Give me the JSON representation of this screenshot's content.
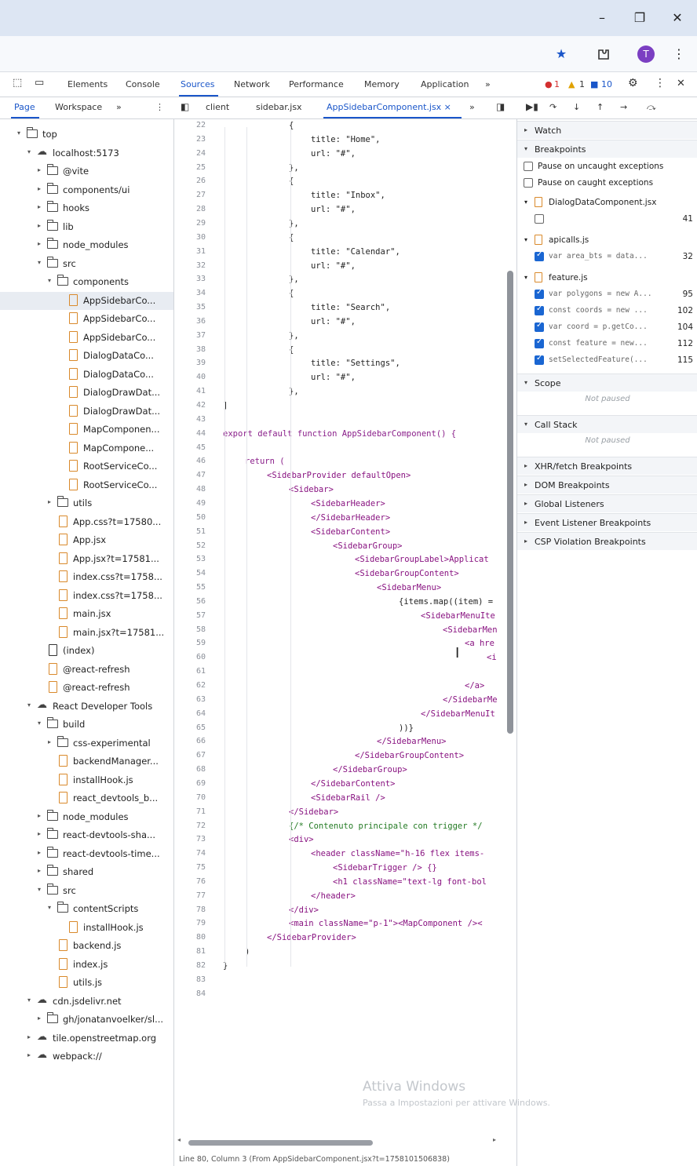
{
  "window": {
    "minimize": "–",
    "maximize": "❐",
    "close": "✕"
  },
  "browser_toolbar": {
    "icons": [
      "star-icon",
      "extension-icon",
      "profile-icon",
      "menu-icon"
    ],
    "profile_initial": "T"
  },
  "devtools_tabs": [
    "Elements",
    "Console",
    "Sources",
    "Network",
    "Performance",
    "Memory",
    "Application",
    "»"
  ],
  "devtools_active_tab": "Sources",
  "devtools_status": {
    "errors": "1",
    "warnings": "1",
    "info": "10"
  },
  "sources_subtabs": {
    "left": [
      "Page",
      "Workspace",
      "»"
    ],
    "files": [
      "client",
      "sidebar.jsx",
      "AppSidebarComponent.jsx ×"
    ],
    "more": "»"
  },
  "tree": [
    {
      "depth": 0,
      "kind": "folder",
      "twisty": "▾",
      "label": "top"
    },
    {
      "depth": 1,
      "kind": "cloud",
      "twisty": "▾",
      "label": "localhost:5173"
    },
    {
      "depth": 2,
      "kind": "folder",
      "twisty": "▸",
      "label": "@vite"
    },
    {
      "depth": 2,
      "kind": "folder",
      "twisty": "▸",
      "label": "components/ui"
    },
    {
      "depth": 2,
      "kind": "folder",
      "twisty": "▸",
      "label": "hooks"
    },
    {
      "depth": 2,
      "kind": "folder",
      "twisty": "▸",
      "label": "lib"
    },
    {
      "depth": 2,
      "kind": "folder",
      "twisty": "▸",
      "label": "node_modules"
    },
    {
      "depth": 2,
      "kind": "folder",
      "twisty": "▾",
      "label": "src"
    },
    {
      "depth": 3,
      "kind": "folder",
      "twisty": "▾",
      "label": "components"
    },
    {
      "depth": 4,
      "kind": "js",
      "twisty": "",
      "label": "AppSidebarCo...",
      "selected": true
    },
    {
      "depth": 4,
      "kind": "js",
      "twisty": "",
      "label": "AppSidebarCo..."
    },
    {
      "depth": 4,
      "kind": "js",
      "twisty": "",
      "label": "AppSidebarCo..."
    },
    {
      "depth": 4,
      "kind": "js",
      "twisty": "",
      "label": "DialogDataCo..."
    },
    {
      "depth": 4,
      "kind": "js",
      "twisty": "",
      "label": "DialogDataCo..."
    },
    {
      "depth": 4,
      "kind": "js",
      "twisty": "",
      "label": "DialogDrawDat..."
    },
    {
      "depth": 4,
      "kind": "js",
      "twisty": "",
      "label": "DialogDrawDat..."
    },
    {
      "depth": 4,
      "kind": "js",
      "twisty": "",
      "label": "MapComponen..."
    },
    {
      "depth": 4,
      "kind": "js",
      "twisty": "",
      "label": "MapCompone..."
    },
    {
      "depth": 4,
      "kind": "js",
      "twisty": "",
      "label": "RootServiceCo..."
    },
    {
      "depth": 4,
      "kind": "js",
      "twisty": "",
      "label": "RootServiceCo..."
    },
    {
      "depth": 3,
      "kind": "folder",
      "twisty": "▸",
      "label": "utils"
    },
    {
      "depth": 3,
      "kind": "js",
      "twisty": "",
      "label": "App.css?t=17580..."
    },
    {
      "depth": 3,
      "kind": "js",
      "twisty": "",
      "label": "App.jsx"
    },
    {
      "depth": 3,
      "kind": "js",
      "twisty": "",
      "label": "App.jsx?t=17581..."
    },
    {
      "depth": 3,
      "kind": "js",
      "twisty": "",
      "label": "index.css?t=1758..."
    },
    {
      "depth": 3,
      "kind": "js",
      "twisty": "",
      "label": "index.css?t=1758..."
    },
    {
      "depth": 3,
      "kind": "js",
      "twisty": "",
      "label": "main.jsx"
    },
    {
      "depth": 3,
      "kind": "js",
      "twisty": "",
      "label": "main.jsx?t=17581..."
    },
    {
      "depth": 2,
      "kind": "file",
      "twisty": "",
      "label": "(index)"
    },
    {
      "depth": 2,
      "kind": "js",
      "twisty": "",
      "label": "@react-refresh"
    },
    {
      "depth": 2,
      "kind": "js",
      "twisty": "",
      "label": "@react-refresh"
    },
    {
      "depth": 1,
      "kind": "cloud",
      "twisty": "▾",
      "label": "React Developer Tools"
    },
    {
      "depth": 2,
      "kind": "folder",
      "twisty": "▾",
      "label": "build"
    },
    {
      "depth": 3,
      "kind": "folder",
      "twisty": "▸",
      "label": "css-experimental"
    },
    {
      "depth": 3,
      "kind": "js",
      "twisty": "",
      "label": "backendManager..."
    },
    {
      "depth": 3,
      "kind": "js",
      "twisty": "",
      "label": "installHook.js"
    },
    {
      "depth": 3,
      "kind": "js",
      "twisty": "",
      "label": "react_devtools_b..."
    },
    {
      "depth": 2,
      "kind": "folder",
      "twisty": "▸",
      "label": "node_modules"
    },
    {
      "depth": 2,
      "kind": "folder",
      "twisty": "▸",
      "label": "react-devtools-sha..."
    },
    {
      "depth": 2,
      "kind": "folder",
      "twisty": "▸",
      "label": "react-devtools-time..."
    },
    {
      "depth": 2,
      "kind": "folder",
      "twisty": "▸",
      "label": "shared"
    },
    {
      "depth": 2,
      "kind": "folder",
      "twisty": "▾",
      "label": "src"
    },
    {
      "depth": 3,
      "kind": "folder",
      "twisty": "▾",
      "label": "contentScripts"
    },
    {
      "depth": 4,
      "kind": "js",
      "twisty": "",
      "label": "installHook.js"
    },
    {
      "depth": 3,
      "kind": "js",
      "twisty": "",
      "label": "backend.js"
    },
    {
      "depth": 3,
      "kind": "js",
      "twisty": "",
      "label": "index.js"
    },
    {
      "depth": 3,
      "kind": "js",
      "twisty": "",
      "label": "utils.js"
    },
    {
      "depth": 1,
      "kind": "cloud",
      "twisty": "▾",
      "label": "cdn.jsdelivr.net"
    },
    {
      "depth": 2,
      "kind": "folder",
      "twisty": "▸",
      "label": "gh/jonatanvoelker/sl..."
    },
    {
      "depth": 1,
      "kind": "cloud",
      "twisty": "▸",
      "label": "tile.openstreetmap.org"
    },
    {
      "depth": 1,
      "kind": "cloud",
      "twisty": "▸",
      "label": "webpack://"
    }
  ],
  "code": [
    {
      "n": "22",
      "t": "{",
      "c": "txt",
      "i": 3
    },
    {
      "n": "23",
      "t": "title: \"Home\",",
      "c": "txt",
      "i": 4
    },
    {
      "n": "24",
      "t": "url: \"#\",",
      "c": "txt",
      "i": 4
    },
    {
      "n": "25",
      "t": "},",
      "c": "txt",
      "i": 3
    },
    {
      "n": "26",
      "t": "{",
      "c": "txt",
      "i": 3
    },
    {
      "n": "27",
      "t": "title: \"Inbox\",",
      "c": "txt",
      "i": 4
    },
    {
      "n": "28",
      "t": "url: \"#\",",
      "c": "txt",
      "i": 4
    },
    {
      "n": "29",
      "t": "},",
      "c": "txt",
      "i": 3
    },
    {
      "n": "30",
      "t": "{",
      "c": "txt",
      "i": 3
    },
    {
      "n": "31",
      "t": "title: \"Calendar\",",
      "c": "txt",
      "i": 4
    },
    {
      "n": "32",
      "t": "url: \"#\",",
      "c": "txt",
      "i": 4
    },
    {
      "n": "33",
      "t": "},",
      "c": "txt",
      "i": 3
    },
    {
      "n": "34",
      "t": "{",
      "c": "txt",
      "i": 3
    },
    {
      "n": "35",
      "t": "title: \"Search\",",
      "c": "txt",
      "i": 4
    },
    {
      "n": "36",
      "t": "url: \"#\",",
      "c": "txt",
      "i": 4
    },
    {
      "n": "37",
      "t": "},",
      "c": "txt",
      "i": 3
    },
    {
      "n": "38",
      "t": "{",
      "c": "txt",
      "i": 3
    },
    {
      "n": "39",
      "t": "title: \"Settings\",",
      "c": "txt",
      "i": 4
    },
    {
      "n": "40",
      "t": "url: \"#\",",
      "c": "txt",
      "i": 4
    },
    {
      "n": "41",
      "t": "},",
      "c": "txt",
      "i": 3
    },
    {
      "n": "42",
      "t": "]",
      "c": "txt",
      "i": 0
    },
    {
      "n": "43",
      "t": "",
      "c": "txt",
      "i": 0
    },
    {
      "n": "44",
      "t": "export default function AppSidebarComponent() {",
      "c": "kw",
      "i": 0
    },
    {
      "n": "45",
      "t": "",
      "c": "txt",
      "i": 0
    },
    {
      "n": "46",
      "t": "return (",
      "c": "kw",
      "i": 1
    },
    {
      "n": "47",
      "t": "<SidebarProvider defaultOpen>",
      "c": "tag",
      "i": 2
    },
    {
      "n": "48",
      "t": "<Sidebar>",
      "c": "tag",
      "i": 3
    },
    {
      "n": "49",
      "t": "<SidebarHeader>",
      "c": "tag",
      "i": 4
    },
    {
      "n": "50",
      "t": "</SidebarHeader>",
      "c": "tag",
      "i": 4
    },
    {
      "n": "51",
      "t": "<SidebarContent>",
      "c": "tag",
      "i": 4
    },
    {
      "n": "52",
      "t": "<SidebarGroup>",
      "c": "tag",
      "i": 5
    },
    {
      "n": "53",
      "t": "<SidebarGroupLabel>Applicat",
      "c": "tag",
      "i": 6
    },
    {
      "n": "54",
      "t": "<SidebarGroupContent>",
      "c": "tag",
      "i": 6
    },
    {
      "n": "55",
      "t": "<SidebarMenu>",
      "c": "tag",
      "i": 7
    },
    {
      "n": "56",
      "t": "{items.map((item) =",
      "c": "txt",
      "i": 8
    },
    {
      "n": "57",
      "t": "<SidebarMenuIte",
      "c": "tag",
      "i": 9
    },
    {
      "n": "58",
      "t": "<SidebarMen",
      "c": "tag",
      "i": 10
    },
    {
      "n": "59",
      "t": "<a hre",
      "c": "tag",
      "i": 11
    },
    {
      "n": "60",
      "t": "<i",
      "c": "tag",
      "i": 12
    },
    {
      "n": "61",
      "t": "",
      "c": "txt",
      "i": 0
    },
    {
      "n": "62",
      "t": "</a>",
      "c": "tag",
      "i": 11
    },
    {
      "n": "63",
      "t": "</SidebarMe",
      "c": "tag",
      "i": 10
    },
    {
      "n": "64",
      "t": "</SidebarMenuIt",
      "c": "tag",
      "i": 9
    },
    {
      "n": "65",
      "t": "))}",
      "c": "txt",
      "i": 8
    },
    {
      "n": "66",
      "t": "</SidebarMenu>",
      "c": "tag",
      "i": 7
    },
    {
      "n": "67",
      "t": "</SidebarGroupContent>",
      "c": "tag",
      "i": 6
    },
    {
      "n": "68",
      "t": "</SidebarGroup>",
      "c": "tag",
      "i": 5
    },
    {
      "n": "69",
      "t": "</SidebarContent>",
      "c": "tag",
      "i": 4
    },
    {
      "n": "70",
      "t": "<SidebarRail />",
      "c": "tag",
      "i": 4
    },
    {
      "n": "71",
      "t": "</Sidebar>",
      "c": "tag",
      "i": 3
    },
    {
      "n": "72",
      "t": "{/* Contenuto principale con trigger */",
      "c": "cm",
      "i": 3
    },
    {
      "n": "73",
      "t": "<div>",
      "c": "tag",
      "i": 3
    },
    {
      "n": "74",
      "t": "<header className=\"h-16 flex items-",
      "c": "tag",
      "i": 4
    },
    {
      "n": "75",
      "t": "<SidebarTrigger /> {}",
      "c": "tag",
      "i": 5
    },
    {
      "n": "76",
      "t": "<h1 className=\"text-lg font-bol",
      "c": "tag",
      "i": 5
    },
    {
      "n": "77",
      "t": "</header>",
      "c": "tag",
      "i": 4
    },
    {
      "n": "78",
      "t": "</div>",
      "c": "tag",
      "i": 3
    },
    {
      "n": "79",
      "t": "<main className=\"p-1\"><MapComponent /><",
      "c": "tag",
      "i": 3
    },
    {
      "n": "80",
      "t": "</SidebarProvider>",
      "c": "tag",
      "i": 2
    },
    {
      "n": "81",
      "t": ")",
      "c": "txt",
      "i": 1
    },
    {
      "n": "82",
      "t": "}",
      "c": "txt",
      "i": 0
    },
    {
      "n": "83",
      "t": "",
      "c": "txt",
      "i": 0
    },
    {
      "n": "84",
      "t": "",
      "c": "txt",
      "i": 0
    }
  ],
  "right_panel": {
    "watch": "Watch",
    "breakpoints": "Breakpoints",
    "pause_uncaught": "Pause on uncaught exceptions",
    "pause_caught": "Pause on caught exceptions",
    "bp_files": [
      {
        "file": "DialogDataComponent.jsx",
        "items": [
          {
            "code": "",
            "line": "41",
            "checked": false
          }
        ]
      },
      {
        "file": "apicalls.js",
        "items": [
          {
            "code": "var area_bts = data...",
            "line": "32",
            "checked": true
          }
        ]
      },
      {
        "file": "feature.js",
        "items": [
          {
            "code": "var polygons = new A...",
            "line": "95",
            "checked": true
          },
          {
            "code": "const coords = new ...",
            "line": "102",
            "checked": true
          },
          {
            "code": "var coord = p.getCo...",
            "line": "104",
            "checked": true
          },
          {
            "code": "const feature = new...",
            "line": "112",
            "checked": true
          },
          {
            "code": "setSelectedFeature(...",
            "line": "115",
            "checked": true
          }
        ]
      }
    ],
    "scope": "Scope",
    "not_paused_1": "Not paused",
    "call_stack": "Call Stack",
    "not_paused_2": "Not paused",
    "sections": [
      "XHR/fetch Breakpoints",
      "DOM Breakpoints",
      "Global Listeners",
      "Event Listener Breakpoints",
      "CSP Violation Breakpoints"
    ]
  },
  "watermark": {
    "title": "Attiva Windows",
    "subtitle": "Passa a Impostazioni per attivare Windows."
  },
  "statusbar": "Line 80, Column 3 (From AppSidebarComponent.jsx?t=1758101506838)"
}
